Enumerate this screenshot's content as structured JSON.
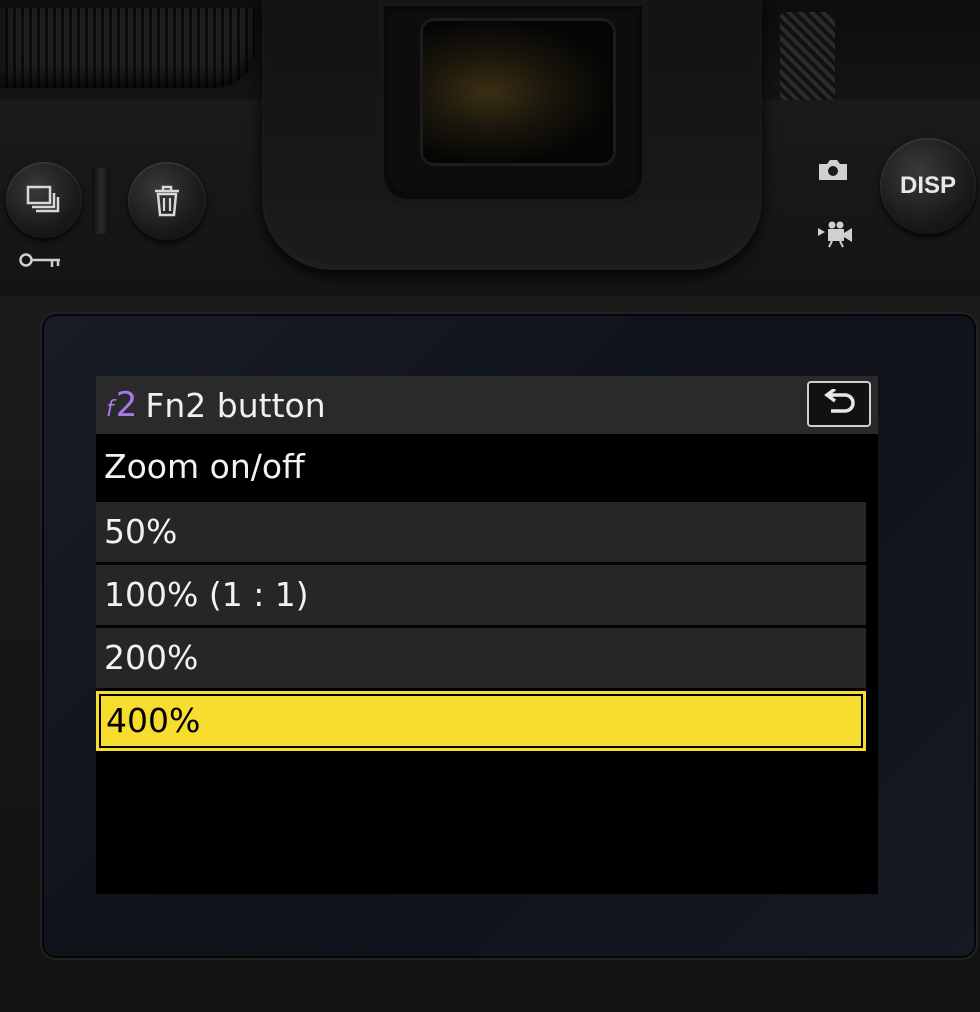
{
  "camera": {
    "disp_label": "DISP",
    "icons": [
      "playback-icon",
      "trash-icon",
      "key-icon",
      "photo-mode-icon",
      "video-mode-icon"
    ]
  },
  "menu": {
    "header": {
      "menu_letter": "f",
      "menu_number": "2",
      "title": "Fn2 button",
      "back_icon": "return-arrow-icon"
    },
    "item_title": "Zoom on/off",
    "options": [
      {
        "label": "50%",
        "selected": false
      },
      {
        "label": "100% (1 : 1)",
        "selected": false
      },
      {
        "label": "200%",
        "selected": false
      },
      {
        "label": "400%",
        "selected": true
      }
    ]
  },
  "colors": {
    "highlight": "#f6dd2e",
    "menu_accent": "#a779e9",
    "row_background": "#262628",
    "header_background": "#2a2a2c"
  }
}
